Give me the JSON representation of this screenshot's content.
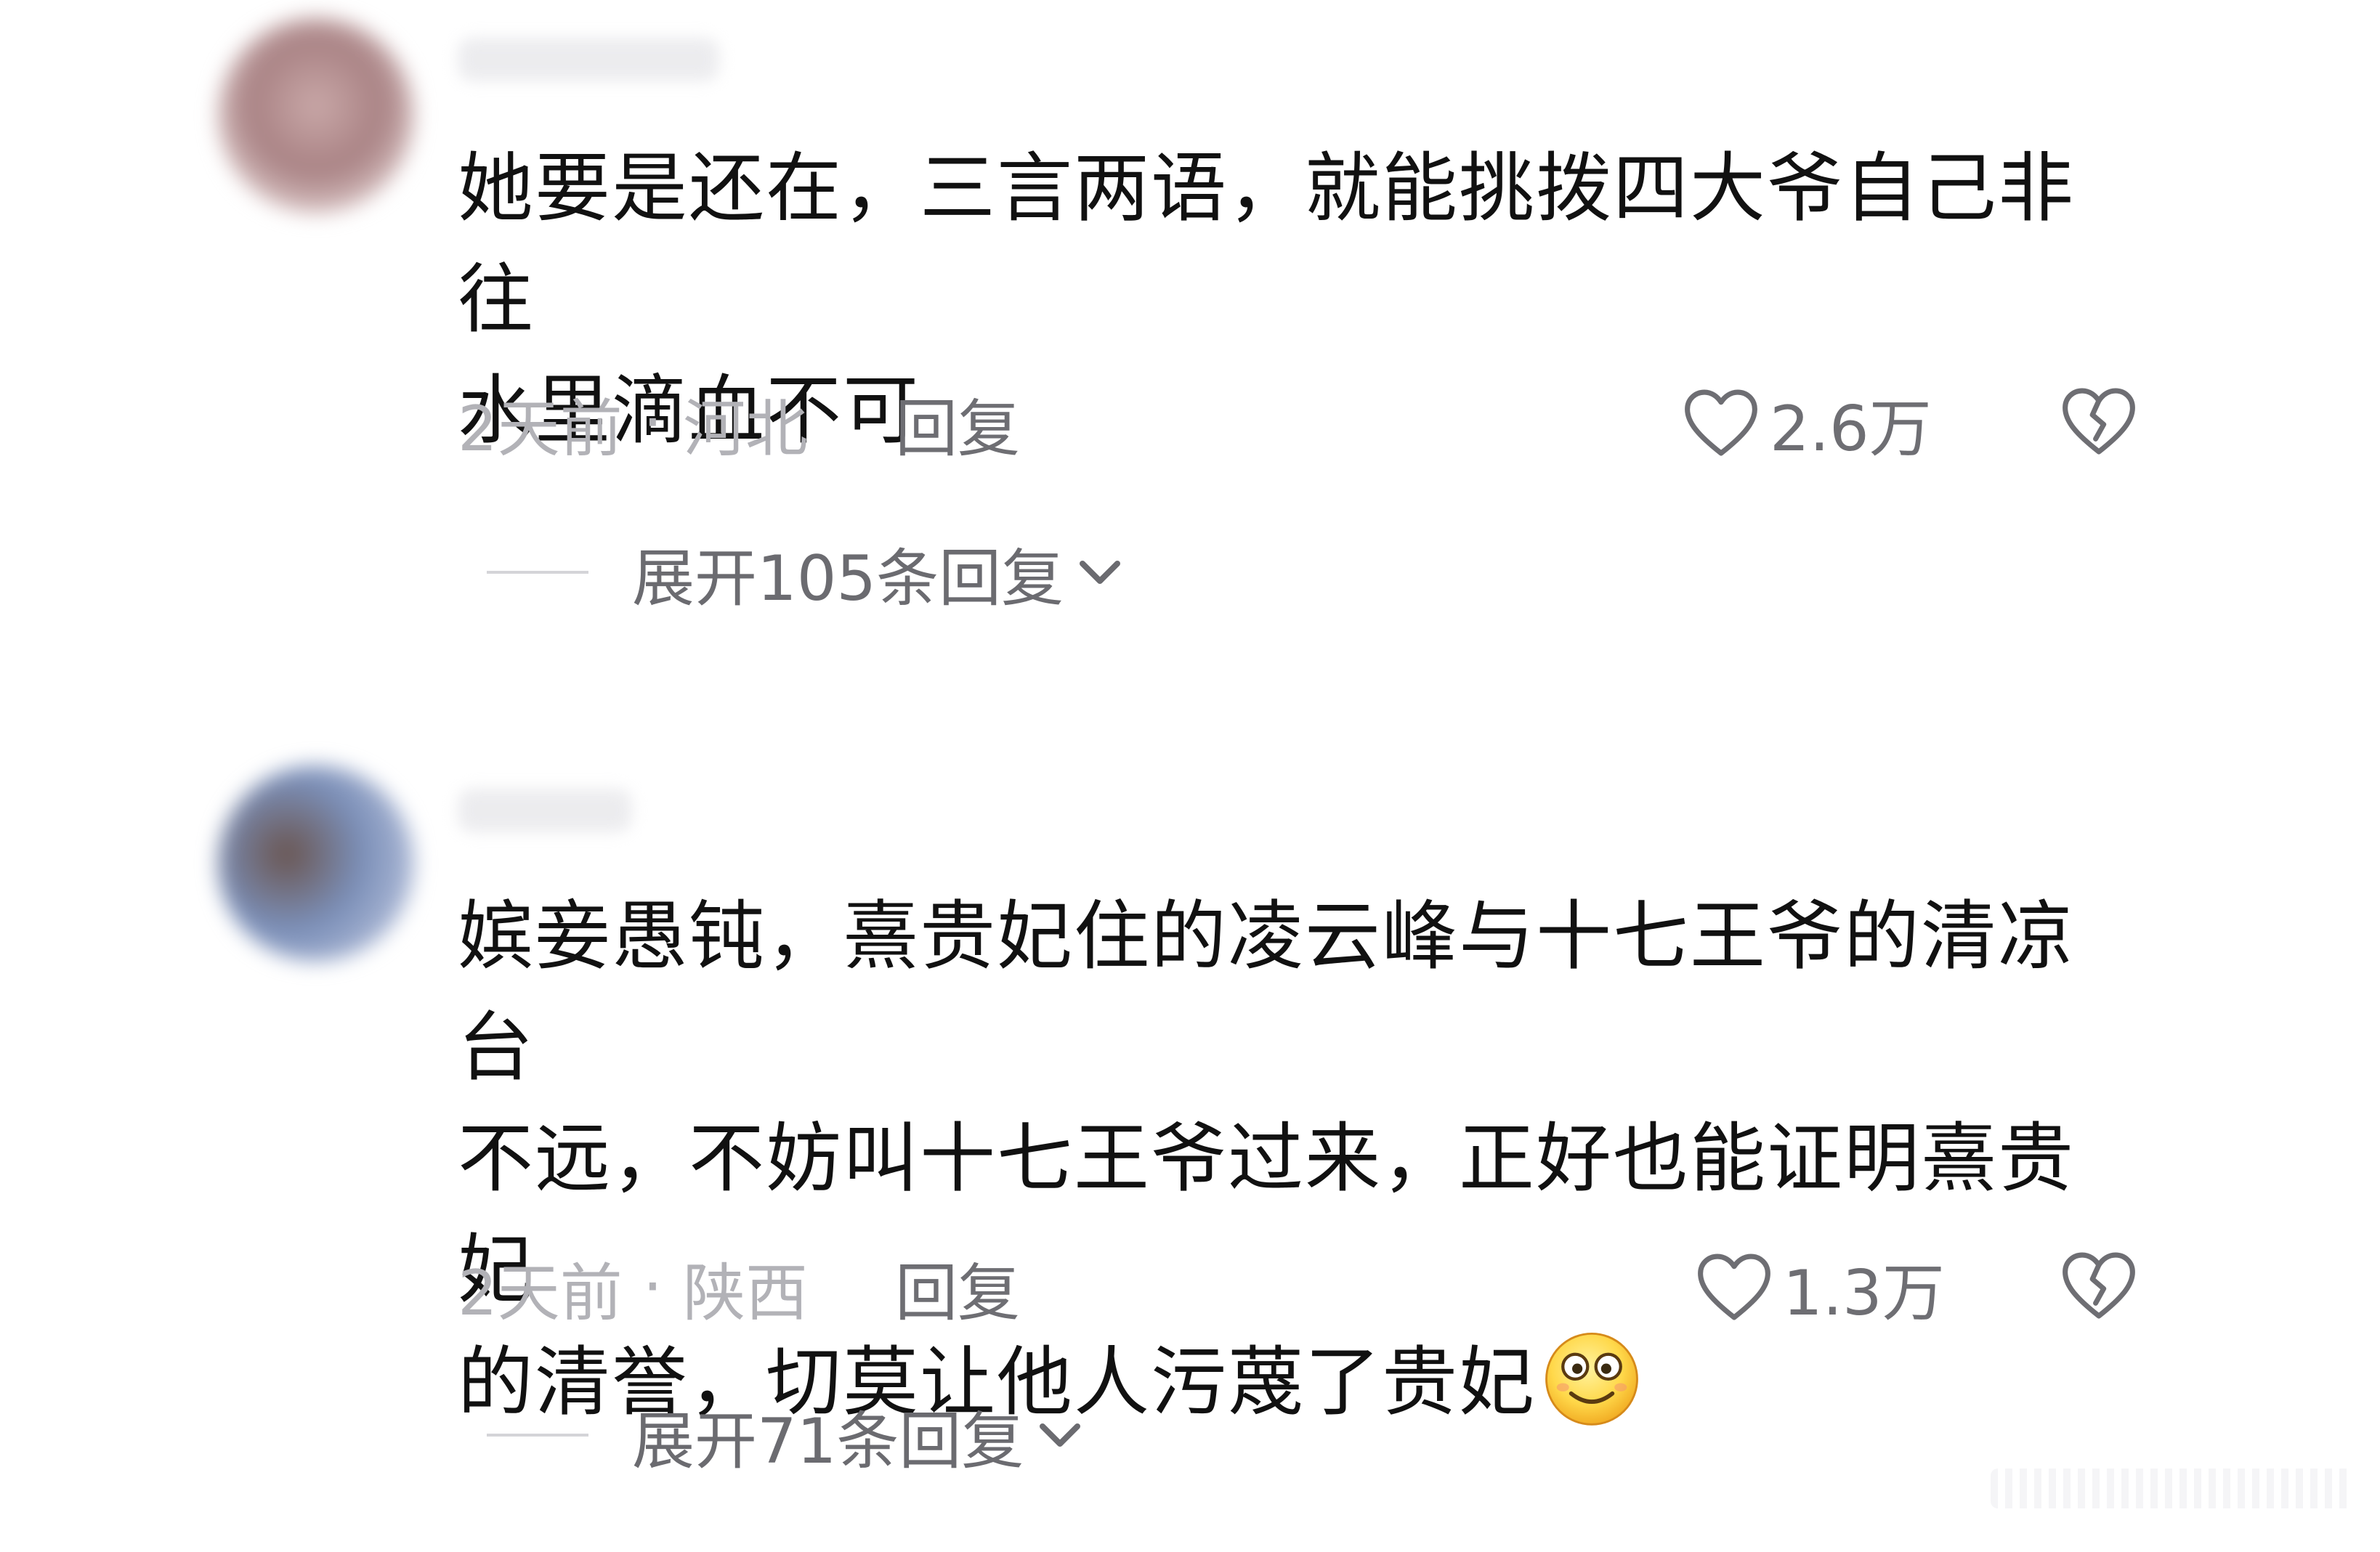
{
  "comments": [
    {
      "text_lines": [
        "她要是还在，三言两语，就能挑拨四大爷自己非往",
        "水里滴血不可"
      ],
      "time": "2天前",
      "separator": "·",
      "location": "河北",
      "reply_label": "回复",
      "likes": "2.6万",
      "expand_label": "展开105条回复"
    },
    {
      "text_lines": [
        "嫔妾愚钝，熹贵妃住的凌云峰与十七王爷的清凉台",
        "不远，不妨叫十七王爷过来，正好也能证明熹贵妃",
        "的清誉，切莫让他人污蔑了贵妃"
      ],
      "time": "2天前",
      "separator": "·",
      "location": "陕西",
      "reply_label": "回复",
      "likes": "1.3万",
      "expand_label": "展开71条回复",
      "emoji": "smiling-face-emoji"
    }
  ],
  "icons": {
    "like": "heart-outline-icon",
    "dislike": "broken-heart-icon",
    "expand": "chevron-down-icon"
  },
  "colors": {
    "text": "#111111",
    "meta": "#b2b2b7",
    "action": "#6e6e73",
    "emoji_face": "#ffd84a"
  }
}
